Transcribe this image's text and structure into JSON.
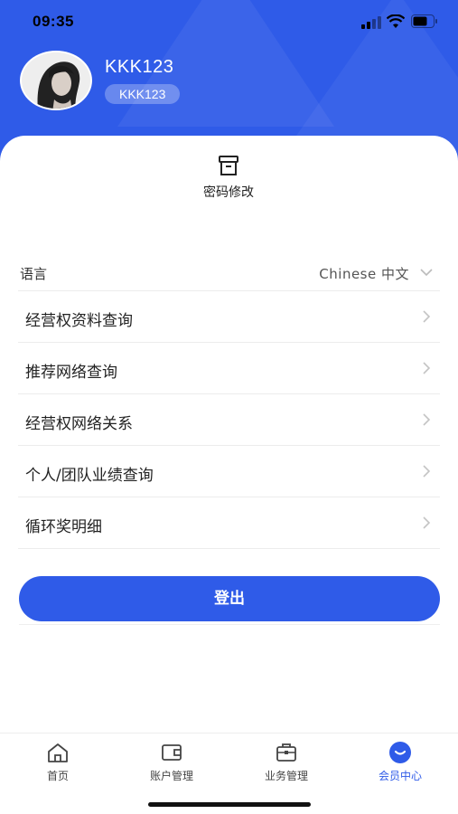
{
  "status_bar": {
    "time": "09:35"
  },
  "profile": {
    "username": "KKK123",
    "badge": "KKK123"
  },
  "password_change": {
    "label": "密码修改"
  },
  "language": {
    "label": "语言",
    "value": "Chinese 中文"
  },
  "menu": {
    "items": [
      {
        "label": "经营权资料查询"
      },
      {
        "label": "推荐网络查询"
      },
      {
        "label": "经营权网络关系"
      },
      {
        "label": "个人/团队业绩查询"
      },
      {
        "label": "循环奖明细"
      }
    ]
  },
  "logout": {
    "label": "登出"
  },
  "tab_bar": {
    "tabs": [
      {
        "label": "首页",
        "icon": "home-icon"
      },
      {
        "label": "账户管理",
        "icon": "wallet-icon"
      },
      {
        "label": "业务管理",
        "icon": "briefcase-icon"
      },
      {
        "label": "会员中心",
        "icon": "member-icon",
        "active": true
      }
    ]
  },
  "colors": {
    "primary": "#2f5be8",
    "background": "#ffffff",
    "divider": "#ececec"
  }
}
